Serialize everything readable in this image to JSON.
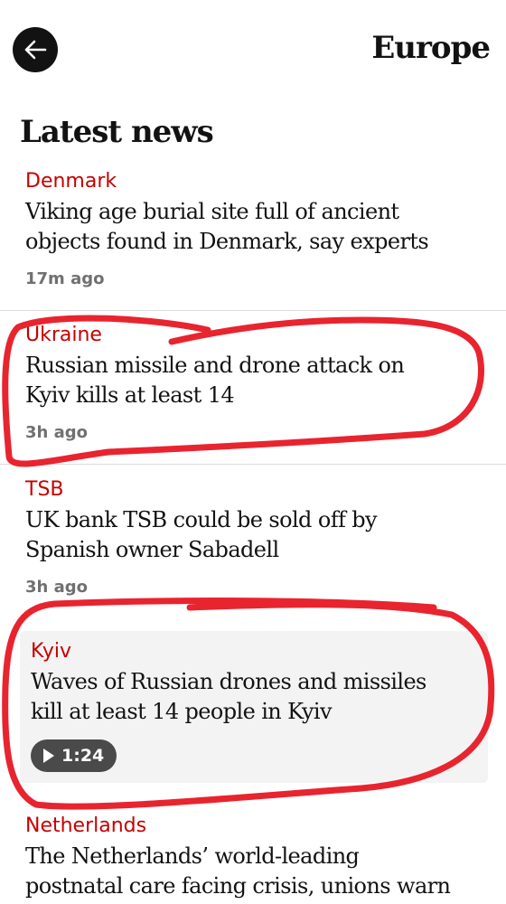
{
  "header": {
    "title": "Europe",
    "back_icon": "arrow-left-icon"
  },
  "list": {
    "heading": "Latest news",
    "items": [
      {
        "kicker": "Denmark",
        "headline_lines": [
          "Viking age burial site full of ancient",
          "objects found in Denmark, say experts"
        ],
        "age": "17m ago"
      },
      {
        "kicker": "Ukraine",
        "headline_lines": [
          "Russian missile and drone attack on",
          "Kyiv kills at least 14"
        ],
        "age": "3h ago"
      },
      {
        "kicker": "TSB",
        "headline_lines": [
          "UK bank TSB could be sold off by",
          "Spanish owner Sabadell"
        ],
        "age": "3h ago"
      },
      {
        "kicker": "Kyiv",
        "headline_lines": [
          "Waves of Russian drones and missiles",
          "kill at least 14 people in Kyiv"
        ],
        "video_duration": "1:24",
        "play_icon": "play-icon"
      },
      {
        "kicker": "Netherlands",
        "headline_lines": [
          "The Netherlands’ world-leading",
          "postnatal care facing crisis, unions warn"
        ]
      }
    ]
  },
  "colors": {
    "kicker_red": "#c70000",
    "annotation_red": "#e8242f",
    "text": "#121212",
    "muted": "#707070",
    "card_bg": "#f3f3f3"
  }
}
